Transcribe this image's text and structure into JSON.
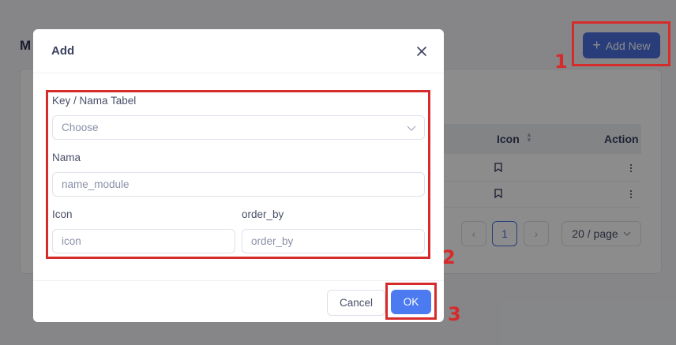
{
  "background": {
    "page_title": "M",
    "add_new_label": "Add New",
    "table": {
      "columns": [
        "Icon",
        "Action"
      ],
      "rows": 2
    },
    "pagination": {
      "current_page": "1",
      "prev_symbol": "‹",
      "next_symbol": "›",
      "page_size": "20 / page"
    }
  },
  "modal": {
    "title": "Add",
    "fields": {
      "key_label": "Key / Nama Tabel",
      "key_placeholder": "Choose",
      "nama_label": "Nama",
      "nama_placeholder": "name_module",
      "icon_label": "Icon",
      "icon_placeholder": "icon",
      "order_label": "order_by",
      "order_placeholder": "order_by"
    },
    "cancel_label": "Cancel",
    "ok_label": "OK"
  },
  "annotations": [
    "1",
    "2",
    "3"
  ],
  "colors": {
    "primary": "#4c7af0",
    "annotation": "#d62b2b"
  }
}
